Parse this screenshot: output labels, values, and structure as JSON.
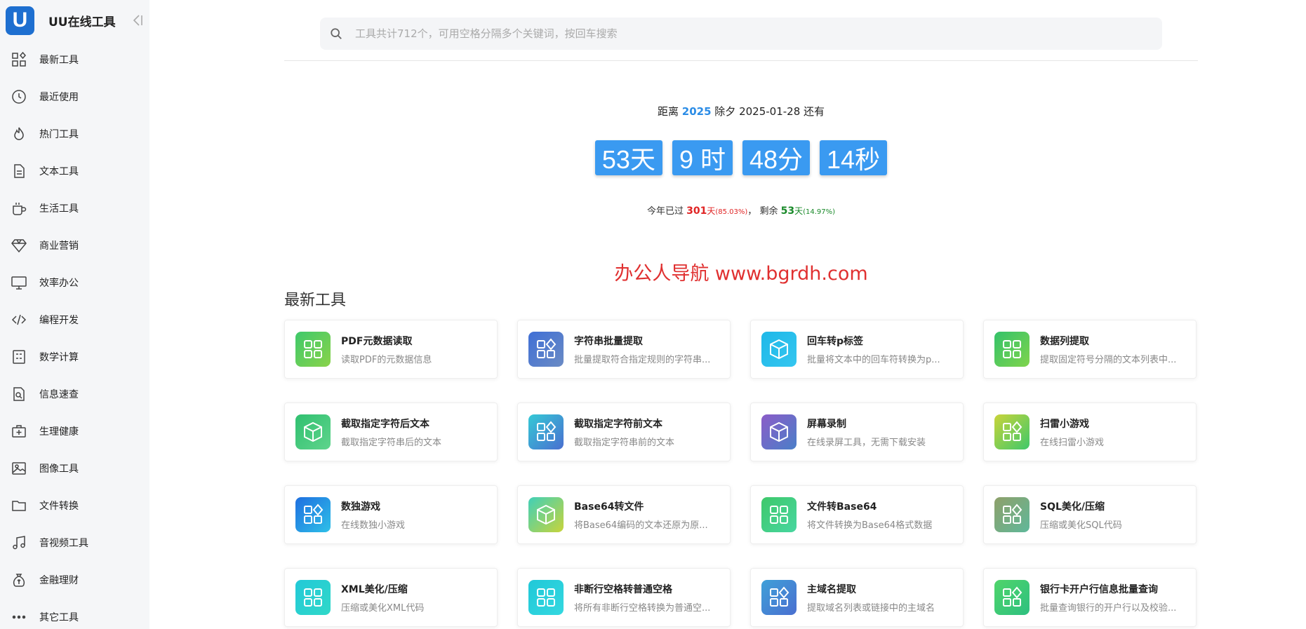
{
  "app": {
    "logo_letter": "U",
    "title": "UU在线工具"
  },
  "sidebar": {
    "items": [
      {
        "label": "最新工具",
        "icon": "grid-icon"
      },
      {
        "label": "最近使用",
        "icon": "clock-icon"
      },
      {
        "label": "热门工具",
        "icon": "fire-icon"
      },
      {
        "label": "文本工具",
        "icon": "document-icon"
      },
      {
        "label": "生活工具",
        "icon": "cup-icon"
      },
      {
        "label": "商业营销",
        "icon": "diamond-icon"
      },
      {
        "label": "效率办公",
        "icon": "monitor-icon"
      },
      {
        "label": "编程开发",
        "icon": "code-icon"
      },
      {
        "label": "数学计算",
        "icon": "calculator-icon"
      },
      {
        "label": "信息速查",
        "icon": "search-doc-icon"
      },
      {
        "label": "生理健康",
        "icon": "medkit-icon"
      },
      {
        "label": "图像工具",
        "icon": "image-icon"
      },
      {
        "label": "文件转换",
        "icon": "folder-icon"
      },
      {
        "label": "音视频工具",
        "icon": "music-icon"
      },
      {
        "label": "金融理财",
        "icon": "money-bag-icon"
      },
      {
        "label": "其它工具",
        "icon": "more-icon"
      }
    ]
  },
  "search": {
    "placeholder": "工具共计712个，可用空格分隔多个关键词，按回车搜索"
  },
  "countdown": {
    "prefix": "距离",
    "year": "2025",
    "event": "除夕 2025-01-28 还有",
    "days": "53天",
    "hours": "9 时",
    "minutes": "48分",
    "seconds": "14秒"
  },
  "year_stat": {
    "passed_label": "今年已过",
    "passed_days": "301",
    "passed_unit": "天",
    "passed_pct": "(85.03%)",
    "sep": "，",
    "remain_label": "剩余",
    "remain_days": "53",
    "remain_unit": "天",
    "remain_pct": "(14.97%)"
  },
  "watermark": "办公人导航 www.bgrdh.com",
  "section_title": "最新工具",
  "colors": {
    "accent": "#3a9af1",
    "sidebar_bg": "#f5f6f8",
    "logo": "#1e6fd0"
  },
  "tools": [
    {
      "title": "PDF元数据读取",
      "desc": "读取PDF的元数据信息",
      "icon": "apps-icon",
      "gradient": [
        "#3ec96b",
        "#8ad34a"
      ]
    },
    {
      "title": "字符串批量提取",
      "desc": "批量提取符合指定规则的字符串...",
      "icon": "apps-diamond-icon",
      "gradient": [
        "#3f6fd6",
        "#6b8bc4"
      ]
    },
    {
      "title": "回车转p标签",
      "desc": "批量将文本中的回车符转换为p...",
      "icon": "cube-icon",
      "gradient": [
        "#1fb8e8",
        "#34c6f0"
      ]
    },
    {
      "title": "数据列提取",
      "desc": "提取固定符号分隔的文本列表中...",
      "icon": "apps-icon",
      "gradient": [
        "#34c26a",
        "#7fd44c"
      ]
    },
    {
      "title": "截取指定字符后文本",
      "desc": "截取指定字符串后的文本",
      "icon": "cube-icon",
      "gradient": [
        "#30c070",
        "#5fd48c"
      ]
    },
    {
      "title": "截取指定字符前文本",
      "desc": "截取指定字符串前的文本",
      "icon": "apps-diamond-icon",
      "gradient": [
        "#34c9d6",
        "#4a6fd0"
      ]
    },
    {
      "title": "屏幕录制",
      "desc": "在线录屏工具，无需下载安装",
      "icon": "cube-icon",
      "gradient": [
        "#8b5cc8",
        "#4a7fc8"
      ]
    },
    {
      "title": "扫雷小游戏",
      "desc": "在线扫雷小游戏",
      "icon": "apps-diamond-icon",
      "gradient": [
        "#c9d43a",
        "#3ec86a"
      ]
    },
    {
      "title": "数独游戏",
      "desc": "在线数独小游戏",
      "icon": "apps-diamond-icon",
      "gradient": [
        "#1f6fe0",
        "#2ec0e8"
      ]
    },
    {
      "title": "Base64转文件",
      "desc": "将Base64编码的文本还原为原...",
      "icon": "cube-icon",
      "gradient": [
        "#40d0b8",
        "#c8d43a"
      ]
    },
    {
      "title": "文件转Base64",
      "desc": "将文件转换为Base64格式数据",
      "icon": "apps-icon",
      "gradient": [
        "#3ec86a",
        "#48d6a0"
      ]
    },
    {
      "title": "SQL美化/压缩",
      "desc": "压缩或美化SQL代码",
      "icon": "apps-diamond-icon",
      "gradient": [
        "#8fa06a",
        "#5fb89a"
      ]
    },
    {
      "title": "XML美化/压缩",
      "desc": "压缩或美化XML代码",
      "icon": "apps-icon",
      "gradient": [
        "#22c9d8",
        "#30d8c8"
      ]
    },
    {
      "title": "非断行空格转普通空格",
      "desc": "将所有非断行空格转换为普通空...",
      "icon": "apps-icon",
      "gradient": [
        "#20c8d8",
        "#34d8e0"
      ]
    },
    {
      "title": "主域名提取",
      "desc": "提取域名列表或链接中的主域名",
      "icon": "apps-diamond-icon",
      "gradient": [
        "#3fa0d8",
        "#4a6fd0"
      ]
    },
    {
      "title": "银行卡开户行信息批量查询",
      "desc": "批量查询银行的开户行以及校验...",
      "icon": "apps-diamond-icon",
      "gradient": [
        "#4fd46a",
        "#2ec080"
      ]
    }
  ]
}
